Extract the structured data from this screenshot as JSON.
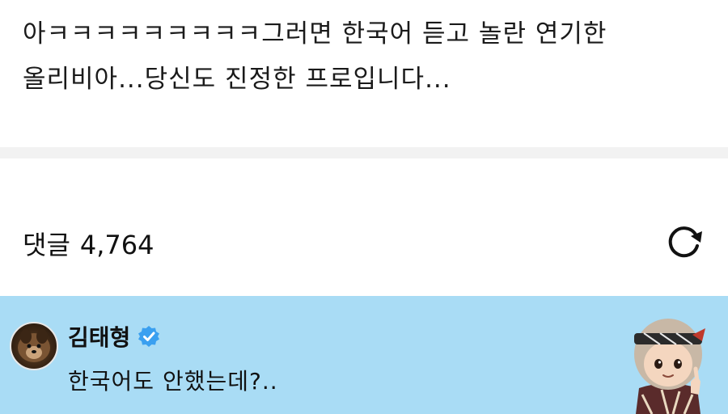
{
  "post": {
    "text": "아ㅋㅋㅋㅋㅋㅋㅋㅋㅋ그러면 한국어 듣고 놀란 연기한\n올리비아...당신도 진정한 프로입니다..."
  },
  "comments": {
    "title": "댓글",
    "count": "4,764"
  },
  "comment": {
    "author": "김태형",
    "text": "한국어도 안했는데?.."
  },
  "colors": {
    "comment_bg": "#a9dcf5",
    "verified_badge": "#3aa0f0",
    "divider": "#f2f2f2"
  },
  "icons": {
    "refresh": "refresh-icon",
    "verified": "verified-badge-icon",
    "avatar": "dog-avatar",
    "sticker": "character-sticker"
  }
}
